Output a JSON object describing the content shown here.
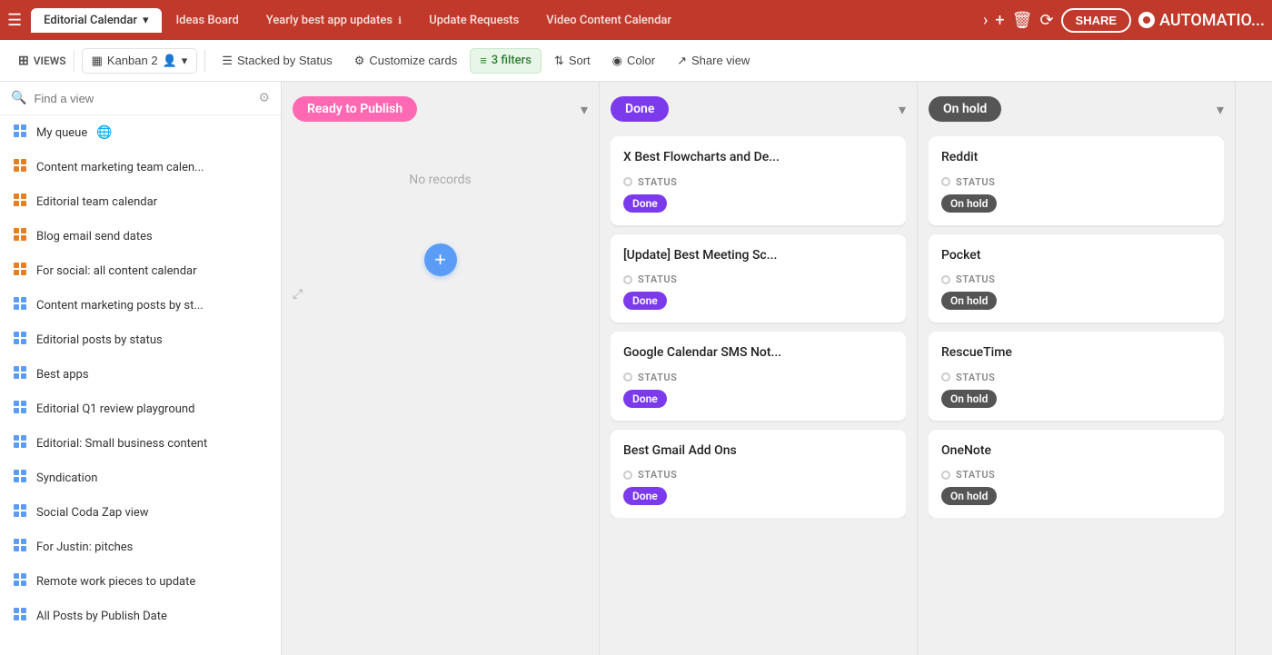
{
  "tabBar": {
    "hamburger": "☰",
    "tabs": [
      {
        "id": "editorial-calendar",
        "label": "Editorial Calendar",
        "active": true,
        "hasDropdown": true
      },
      {
        "id": "ideas-board",
        "label": "Ideas Board",
        "active": false
      },
      {
        "id": "yearly-best",
        "label": "Yearly best app updates",
        "active": false,
        "hasInfo": true
      },
      {
        "id": "update-requests",
        "label": "Update Requests",
        "active": false
      },
      {
        "id": "video-content",
        "label": "Video Content Calendar",
        "active": false
      }
    ],
    "actions": {
      "more": "›",
      "add": "+",
      "delete": "🗑",
      "history": "⟳",
      "share": "SHARE",
      "automation": "AUTOMATIO..."
    }
  },
  "toolbar": {
    "views_label": "VIEWS",
    "kanban_label": "Kanban 2",
    "stacked_label": "Stacked by Status",
    "customize_label": "Customize cards",
    "filters_label": "3 filters",
    "sort_label": "Sort",
    "color_label": "Color",
    "share_label": "Share view"
  },
  "sidebar": {
    "search_placeholder": "Find a view",
    "items": [
      {
        "id": "my-queue",
        "label": "My queue",
        "icon": "grid",
        "emoji": "🌐",
        "color": "#5b9cf6"
      },
      {
        "id": "content-marketing-team",
        "label": "Content marketing team calen...",
        "icon": "grid-orange",
        "color": "#e67e22"
      },
      {
        "id": "editorial-team",
        "label": "Editorial team calendar",
        "icon": "grid-orange",
        "color": "#e67e22"
      },
      {
        "id": "blog-email",
        "label": "Blog email send dates",
        "icon": "grid-orange",
        "color": "#e67e22"
      },
      {
        "id": "for-social",
        "label": "For social: all content calendar",
        "icon": "grid-orange",
        "color": "#e67e22"
      },
      {
        "id": "content-marketing-posts",
        "label": "Content marketing posts by st...",
        "icon": "grid-blue",
        "color": "#5b9cf6"
      },
      {
        "id": "editorial-posts",
        "label": "Editorial posts by status",
        "icon": "grid-blue",
        "color": "#5b9cf6"
      },
      {
        "id": "best-apps",
        "label": "Best apps",
        "icon": "grid-blue",
        "color": "#5b9cf6"
      },
      {
        "id": "editorial-q1",
        "label": "Editorial Q1 review playground",
        "icon": "grid-blue",
        "color": "#5b9cf6"
      },
      {
        "id": "editorial-small",
        "label": "Editorial: Small business content",
        "icon": "grid-blue",
        "color": "#5b9cf6"
      },
      {
        "id": "syndication",
        "label": "Syndication",
        "icon": "grid-blue",
        "color": "#5b9cf6"
      },
      {
        "id": "social-coda",
        "label": "Social Coda Zap view",
        "icon": "grid-blue",
        "color": "#5b9cf6"
      },
      {
        "id": "for-justin",
        "label": "For Justin: pitches",
        "icon": "grid-blue",
        "color": "#5b9cf6"
      },
      {
        "id": "remote-work",
        "label": "Remote work pieces to update",
        "icon": "grid-blue",
        "color": "#5b9cf6"
      },
      {
        "id": "all-posts",
        "label": "All Posts by Publish Date",
        "icon": "grid-blue",
        "color": "#5b9cf6"
      }
    ]
  },
  "columns": [
    {
      "id": "ready-to-publish",
      "label": "Ready to Publish",
      "labelClass": "label-ready",
      "cards": [],
      "noRecords": "No records",
      "showAdd": true
    },
    {
      "id": "done",
      "label": "Done",
      "labelClass": "label-done",
      "cards": [
        {
          "title": "X Best Flowcharts and De...",
          "statusLabel": "STATUS",
          "statusBadge": "Done",
          "badgeClass": "badge-done"
        },
        {
          "title": "[Update] Best Meeting Sc...",
          "statusLabel": "STATUS",
          "statusBadge": "Done",
          "badgeClass": "badge-done"
        },
        {
          "title": "Google Calendar SMS Not...",
          "statusLabel": "STATUS",
          "statusBadge": "Done",
          "badgeClass": "badge-done"
        },
        {
          "title": "Best Gmail Add Ons",
          "statusLabel": "STATUS",
          "statusBadge": "Done",
          "badgeClass": "badge-done"
        }
      ]
    },
    {
      "id": "on-hold",
      "label": "On hold",
      "labelClass": "label-onhold",
      "cards": [
        {
          "title": "Reddit",
          "statusLabel": "STATUS",
          "statusBadge": "On hold",
          "badgeClass": "badge-onhold"
        },
        {
          "title": "Pocket",
          "statusLabel": "STATUS",
          "statusBadge": "On hold",
          "badgeClass": "badge-onhold"
        },
        {
          "title": "RescueTime",
          "statusLabel": "STATUS",
          "statusBadge": "On hold",
          "badgeClass": "badge-onhold"
        },
        {
          "title": "OneNote",
          "statusLabel": "STATUS",
          "statusBadge": "On hold",
          "badgeClass": "badge-onhold"
        }
      ]
    }
  ],
  "icons": {
    "hamburger": "☰",
    "dropdown_arrow": "▾",
    "chevron_right": "›",
    "plus": "+",
    "search": "🔍",
    "settings": "⚙",
    "grid": "⊞",
    "filter": "≡",
    "sort": "⇅",
    "color": "◉",
    "share": "↗",
    "expand": "⤢"
  }
}
